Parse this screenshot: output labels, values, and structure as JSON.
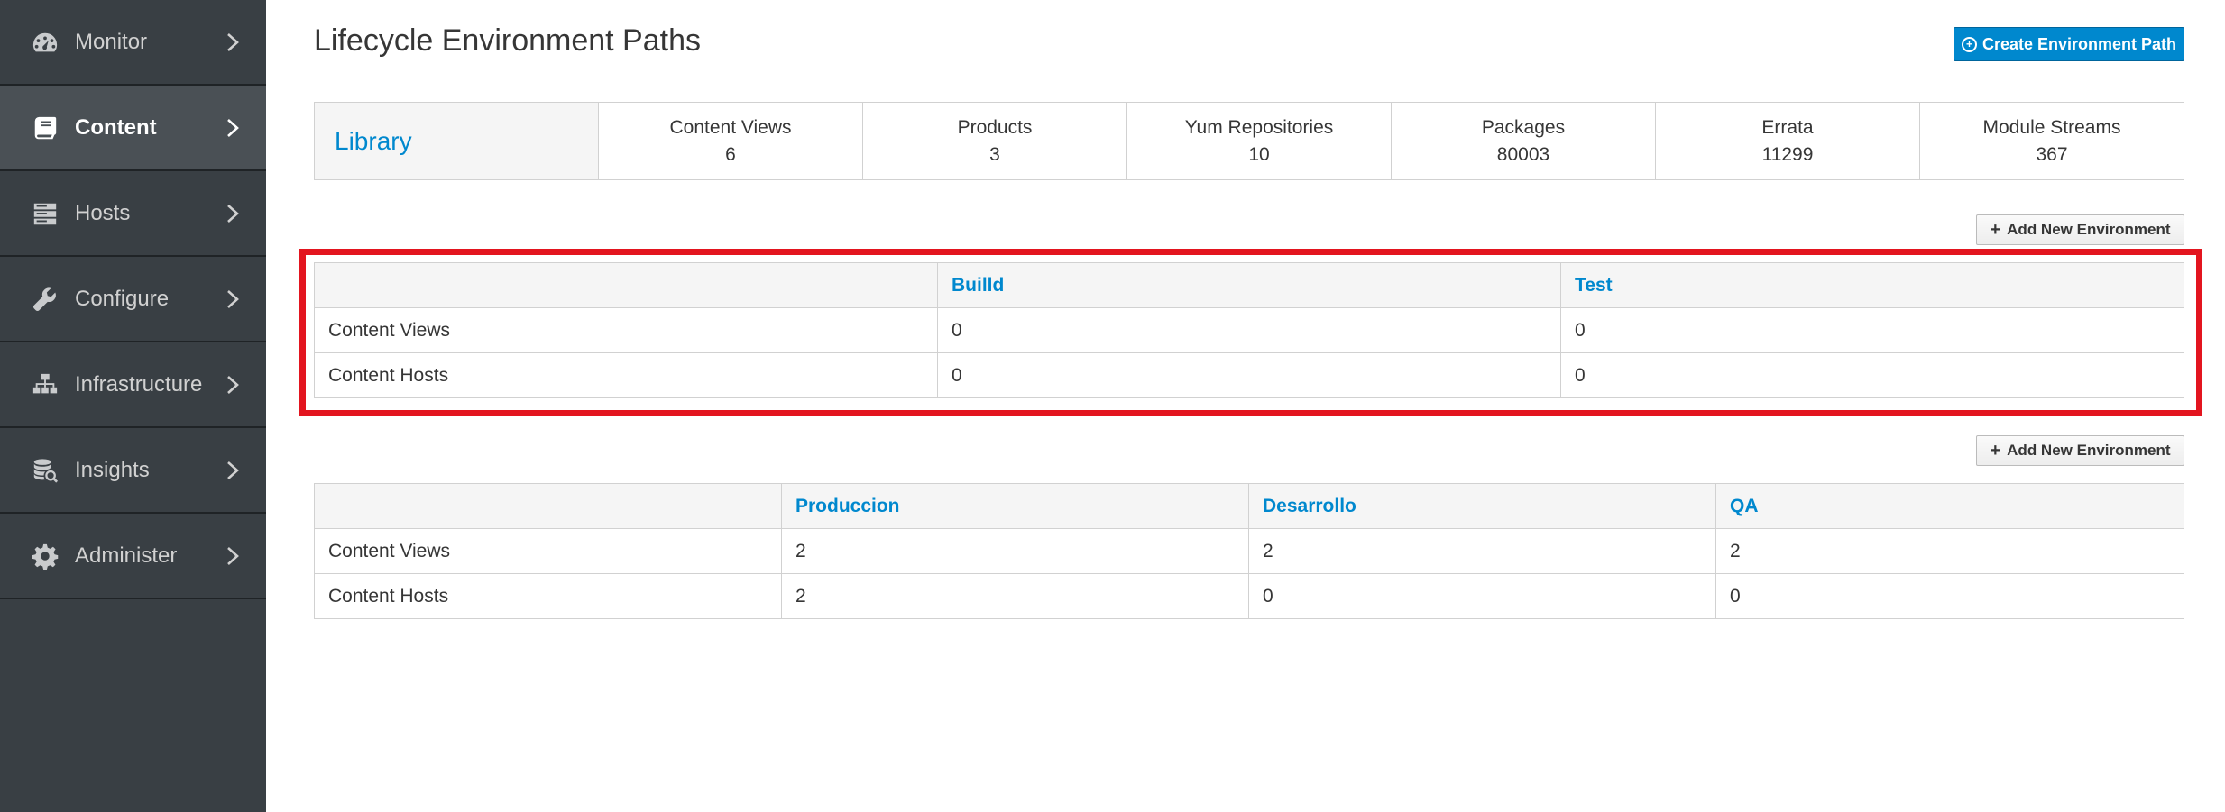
{
  "sidebar": {
    "items": [
      {
        "label": "Monitor",
        "icon": "dashboard-icon",
        "active": false
      },
      {
        "label": "Content",
        "icon": "book-icon",
        "active": true
      },
      {
        "label": "Hosts",
        "icon": "server-icon",
        "active": false
      },
      {
        "label": "Configure",
        "icon": "wrench-icon",
        "active": false
      },
      {
        "label": "Infrastructure",
        "icon": "network-icon",
        "active": false
      },
      {
        "label": "Insights",
        "icon": "database-search-icon",
        "active": false
      },
      {
        "label": "Administer",
        "icon": "gear-icon",
        "active": false
      }
    ]
  },
  "header": {
    "title": "Lifecycle Environment Paths",
    "create_button": "Create Environment Path"
  },
  "library": {
    "name": "Library",
    "stats": [
      {
        "label": "Content Views",
        "value": "6"
      },
      {
        "label": "Products",
        "value": "3"
      },
      {
        "label": "Yum Repositories",
        "value": "10"
      },
      {
        "label": "Packages",
        "value": "80003"
      },
      {
        "label": "Errata",
        "value": "11299"
      },
      {
        "label": "Module Streams",
        "value": "367"
      }
    ]
  },
  "paths": [
    {
      "add_button": "Add New Environment",
      "environments": [
        "Builld",
        "Test"
      ],
      "rows": [
        {
          "label": "Content Views",
          "values": [
            "0",
            "0"
          ]
        },
        {
          "label": "Content Hosts",
          "values": [
            "0",
            "0"
          ]
        }
      ],
      "highlighted": true
    },
    {
      "add_button": "Add New Environment",
      "environments": [
        "Produccion",
        "Desarrollo",
        "QA"
      ],
      "rows": [
        {
          "label": "Content Views",
          "values": [
            "2",
            "2",
            "2"
          ]
        },
        {
          "label": "Content Hosts",
          "values": [
            "2",
            "0",
            "0"
          ]
        }
      ],
      "highlighted": false
    }
  ],
  "colors": {
    "sidebar_bg": "#393f44",
    "link": "#0088ce",
    "primary_button": "#0088ce",
    "highlight_border": "#e3151f"
  }
}
